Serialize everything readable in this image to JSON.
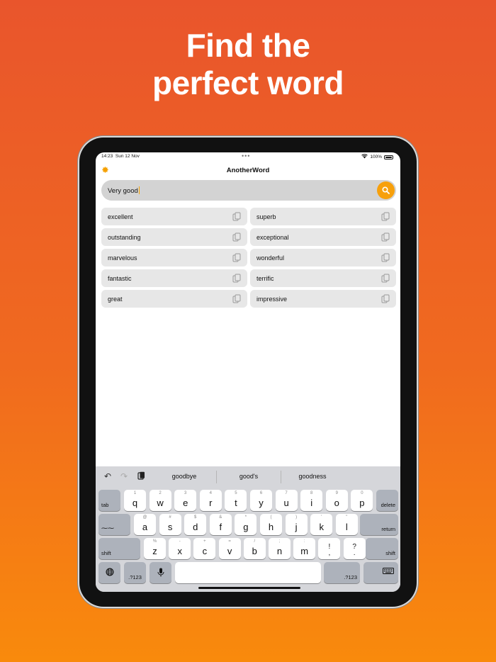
{
  "headline": {
    "line1": "Find the",
    "line2": "perfect word"
  },
  "status_bar": {
    "time": "14:23",
    "date": "Sun 12 Nov",
    "battery": "100%"
  },
  "app": {
    "title": "AnotherWord"
  },
  "search": {
    "value": "Very good"
  },
  "results": [
    "excellent",
    "superb",
    "outstanding",
    "exceptional",
    "marvelous",
    "wonderful",
    "fantastic",
    "terrific",
    "great",
    "impressive"
  ],
  "keyboard": {
    "suggestions": [
      "goodbye",
      "good's",
      "goodness"
    ],
    "row1": [
      {
        "main": "q",
        "alt": "1"
      },
      {
        "main": "w",
        "alt": "2"
      },
      {
        "main": "e",
        "alt": "3"
      },
      {
        "main": "r",
        "alt": "4"
      },
      {
        "main": "t",
        "alt": "5"
      },
      {
        "main": "y",
        "alt": "6"
      },
      {
        "main": "u",
        "alt": "7"
      },
      {
        "main": "i",
        "alt": "8"
      },
      {
        "main": "o",
        "alt": "9"
      },
      {
        "main": "p",
        "alt": "0"
      }
    ],
    "row2": [
      {
        "main": "a",
        "alt": "@"
      },
      {
        "main": "s",
        "alt": "#"
      },
      {
        "main": "d",
        "alt": "$"
      },
      {
        "main": "f",
        "alt": "&"
      },
      {
        "main": "g",
        "alt": "*"
      },
      {
        "main": "h",
        "alt": "("
      },
      {
        "main": "j",
        "alt": ")"
      },
      {
        "main": "k",
        "alt": "'"
      },
      {
        "main": "l",
        "alt": "\""
      }
    ],
    "row3": [
      {
        "main": "z",
        "alt": "%"
      },
      {
        "main": "x",
        "alt": "-"
      },
      {
        "main": "c",
        "alt": "+"
      },
      {
        "main": "v",
        "alt": "="
      },
      {
        "main": "b",
        "alt": "/"
      },
      {
        "main": "n",
        "alt": ";"
      },
      {
        "main": "m",
        "alt": ":"
      },
      {
        "main": "!\n,",
        "alt": ""
      },
      {
        "main": "?\n.",
        "alt": ""
      }
    ],
    "labels": {
      "tab": "tab",
      "delete": "delete",
      "return": "return",
      "shift": "shift",
      "numbers": ".?123",
      "caps_icon": "⁓⁓"
    }
  },
  "colors": {
    "accent": "#f7a00c",
    "bg_top": "#e9552c",
    "bg_bottom": "#f98a0c"
  },
  "icons": [
    "gear-icon",
    "search-icon",
    "copy-icon",
    "undo-icon",
    "redo-icon",
    "paste-icon",
    "globe-icon",
    "microphone-icon",
    "keyboard-dismiss-icon"
  ]
}
